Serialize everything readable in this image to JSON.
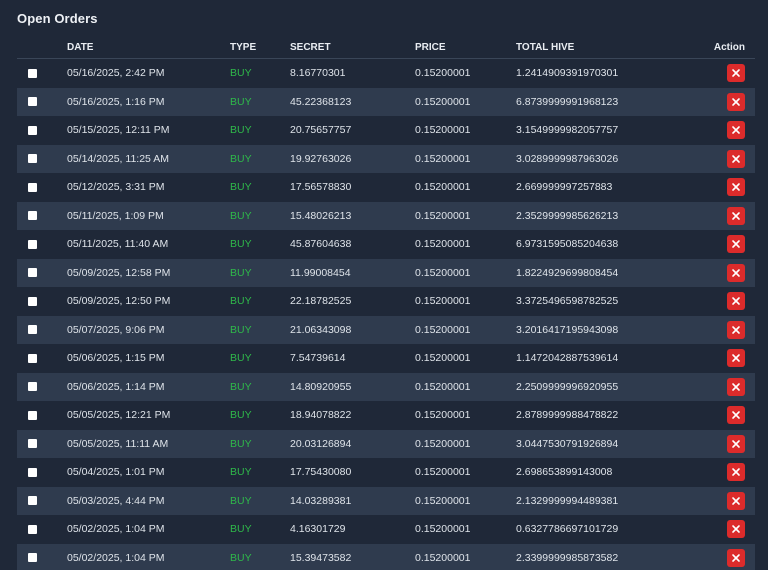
{
  "title": "Open Orders",
  "headers": {
    "date": "DATE",
    "type": "TYPE",
    "secret": "SECRET",
    "price": "PRICE",
    "total": "TOTAL HIVE",
    "action": "Action"
  },
  "colors": {
    "background": "#1f2838",
    "row_alt": "#2f3b4e",
    "buy": "#2fb84a",
    "delete_button": "#dc2b2b"
  },
  "icons": {
    "delete": "close-icon",
    "select": "checkbox"
  },
  "orders": [
    {
      "date": "05/16/2025, 2:42 PM",
      "type": "BUY",
      "secret": "8.16770301",
      "price": "0.15200001",
      "total": "1.2414909391970301"
    },
    {
      "date": "05/16/2025, 1:16 PM",
      "type": "BUY",
      "secret": "45.22368123",
      "price": "0.15200001",
      "total": "6.8739999991968123"
    },
    {
      "date": "05/15/2025, 12:11 PM",
      "type": "BUY",
      "secret": "20.75657757",
      "price": "0.15200001",
      "total": "3.1549999982057757"
    },
    {
      "date": "05/14/2025, 11:25 AM",
      "type": "BUY",
      "secret": "19.92763026",
      "price": "0.15200001",
      "total": "3.0289999987963026"
    },
    {
      "date": "05/12/2025, 3:31 PM",
      "type": "BUY",
      "secret": "17.56578830",
      "price": "0.15200001",
      "total": "2.669999997257883"
    },
    {
      "date": "05/11/2025, 1:09 PM",
      "type": "BUY",
      "secret": "15.48026213",
      "price": "0.15200001",
      "total": "2.3529999985626213"
    },
    {
      "date": "05/11/2025, 11:40 AM",
      "type": "BUY",
      "secret": "45.87604638",
      "price": "0.15200001",
      "total": "6.9731595085204638"
    },
    {
      "date": "05/09/2025, 12:58 PM",
      "type": "BUY",
      "secret": "11.99008454",
      "price": "0.15200001",
      "total": "1.8224929699808454"
    },
    {
      "date": "05/09/2025, 12:50 PM",
      "type": "BUY",
      "secret": "22.18782525",
      "price": "0.15200001",
      "total": "3.3725496598782525"
    },
    {
      "date": "05/07/2025, 9:06 PM",
      "type": "BUY",
      "secret": "21.06343098",
      "price": "0.15200001",
      "total": "3.2016417195943098"
    },
    {
      "date": "05/06/2025, 1:15 PM",
      "type": "BUY",
      "secret": "7.54739614",
      "price": "0.15200001",
      "total": "1.1472042887539614"
    },
    {
      "date": "05/06/2025, 1:14 PM",
      "type": "BUY",
      "secret": "14.80920955",
      "price": "0.15200001",
      "total": "2.2509999996920955"
    },
    {
      "date": "05/05/2025, 12:21 PM",
      "type": "BUY",
      "secret": "18.94078822",
      "price": "0.15200001",
      "total": "2.8789999988478822"
    },
    {
      "date": "05/05/2025, 11:11 AM",
      "type": "BUY",
      "secret": "20.03126894",
      "price": "0.15200001",
      "total": "3.0447530791926894"
    },
    {
      "date": "05/04/2025, 1:01 PM",
      "type": "BUY",
      "secret": "17.75430080",
      "price": "0.15200001",
      "total": "2.698653899143008"
    },
    {
      "date": "05/03/2025, 4:44 PM",
      "type": "BUY",
      "secret": "14.03289381",
      "price": "0.15200001",
      "total": "2.1329999994489381"
    },
    {
      "date": "05/02/2025, 1:04 PM",
      "type": "BUY",
      "secret": "4.16301729",
      "price": "0.15200001",
      "total": "0.6327786697101729"
    },
    {
      "date": "05/02/2025, 1:04 PM",
      "type": "BUY",
      "secret": "15.39473582",
      "price": "0.15200001",
      "total": "2.3399999985873582"
    }
  ]
}
